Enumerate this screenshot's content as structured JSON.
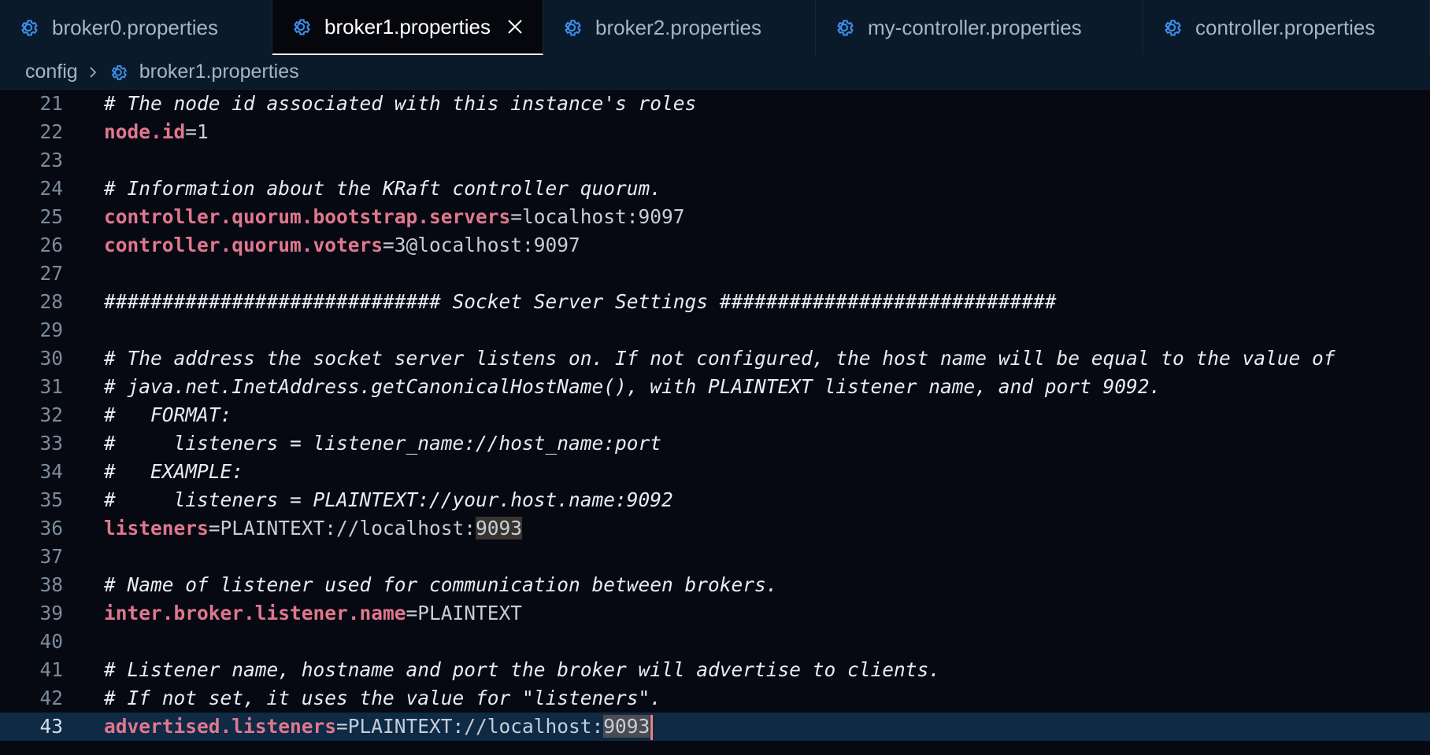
{
  "tabs": [
    {
      "label": "broker0.properties",
      "active": false,
      "width": 346
    },
    {
      "label": "broker1.properties",
      "active": true,
      "width": 344
    },
    {
      "label": "broker2.properties",
      "active": false,
      "width": 346
    },
    {
      "label": "my-controller.properties",
      "active": false,
      "width": 416
    },
    {
      "label": "controller.properties",
      "active": false,
      "width": 364
    }
  ],
  "breadcrumb": {
    "folder": "config",
    "file": "broker1.properties"
  },
  "editor": {
    "current_line": "43",
    "lines": [
      {
        "n": "21",
        "comment": "# The node id associated with this instance's roles"
      },
      {
        "n": "22",
        "key": "node.id",
        "value": "1"
      },
      {
        "n": "23"
      },
      {
        "n": "24",
        "comment": "# Information about the KRaft controller quorum."
      },
      {
        "n": "25",
        "key": "controller.quorum.bootstrap.servers",
        "value": "localhost:9097"
      },
      {
        "n": "26",
        "key": "controller.quorum.voters",
        "value": "3@localhost:9097"
      },
      {
        "n": "27"
      },
      {
        "n": "28",
        "comment": "############################# Socket Server Settings #############################"
      },
      {
        "n": "29"
      },
      {
        "n": "30",
        "comment": "# The address the socket server listens on. If not configured, the host name will be equal to the value of"
      },
      {
        "n": "31",
        "comment": "# java.net.InetAddress.getCanonicalHostName(), with PLAINTEXT listener name, and port 9092."
      },
      {
        "n": "32",
        "comment": "#   FORMAT:"
      },
      {
        "n": "33",
        "comment": "#     listeners = listener_name://host_name:port"
      },
      {
        "n": "34",
        "comment": "#   EXAMPLE:"
      },
      {
        "n": "35",
        "comment": "#     listeners = PLAINTEXT://your.host.name:9092"
      },
      {
        "n": "36",
        "key": "listeners",
        "value": "PLAINTEXT://localhost:",
        "hl": "9093"
      },
      {
        "n": "37"
      },
      {
        "n": "38",
        "comment": "# Name of listener used for communication between brokers."
      },
      {
        "n": "39",
        "key": "inter.broker.listener.name",
        "value": "PLAINTEXT"
      },
      {
        "n": "40"
      },
      {
        "n": "41",
        "comment": "# Listener name, hostname and port the broker will advertise to clients."
      },
      {
        "n": "42",
        "comment": "# If not set, it uses the value for \"listeners\"."
      },
      {
        "n": "43",
        "key": "advertised.listeners",
        "value": "PLAINTEXT://localhost:",
        "hl": "9093",
        "cursor": true
      }
    ]
  },
  "colors": {
    "accent": "#3b8eea",
    "key": "#e0778f",
    "current_line_bg": "#0e2a45",
    "cursor": "#f0817e"
  },
  "icons": {
    "tab_icon": "gear-icon",
    "close": "close-icon",
    "breadcrumb_sep": "chevron-right-icon"
  }
}
